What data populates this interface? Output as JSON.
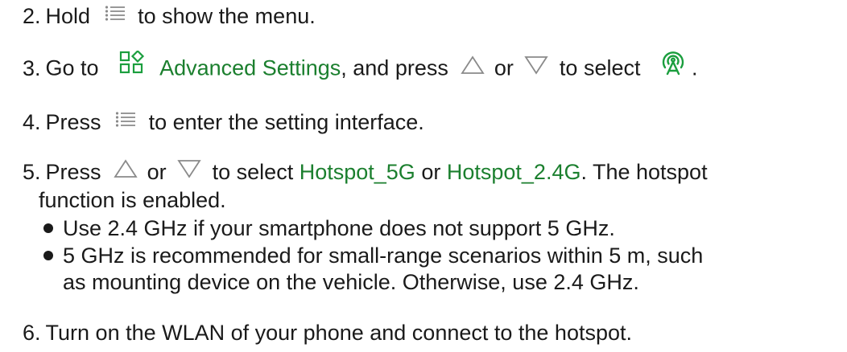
{
  "steps": {
    "s2": {
      "num": "2.",
      "before": "Hold",
      "after": "to show the menu."
    },
    "s3": {
      "num": "3.",
      "before": "Go to",
      "keyword": "Advanced Settings",
      "mid1": ", and press",
      "or": "or",
      "mid2": "to select",
      "end": "."
    },
    "s4": {
      "num": "4.",
      "before": "Press",
      "after": "to enter the setting interface."
    },
    "s5": {
      "num": "5.",
      "before": "Press",
      "or": "or",
      "mid": "to select",
      "kw1": "Hotspot_5G",
      "or2": "or",
      "kw2": "Hotspot_2.4G",
      "after": ". The hotspot",
      "line2": "function is enabled.",
      "bullets": [
        {
          "text": "Use 2.4 GHz if your smartphone does not support 5 GHz."
        },
        {
          "text": "5 GHz is recommended for small-range scenarios within 5 m, such",
          "cont": "as mounting device on the vehicle. Otherwise, use 2.4 GHz."
        }
      ]
    },
    "s6": {
      "num": "6.",
      "text": "Turn on the WLAN of your phone and connect to the hotspot."
    }
  },
  "icons": {
    "menu": "menu-list-icon",
    "advanced": "advanced-settings-icon",
    "up": "up-triangle-icon",
    "down": "down-triangle-icon",
    "hotspot": "hotspot-icon"
  },
  "colors": {
    "accent": "#1b7f2e",
    "text": "#1a1a1a",
    "icon_gray": "#8a8a8a"
  }
}
